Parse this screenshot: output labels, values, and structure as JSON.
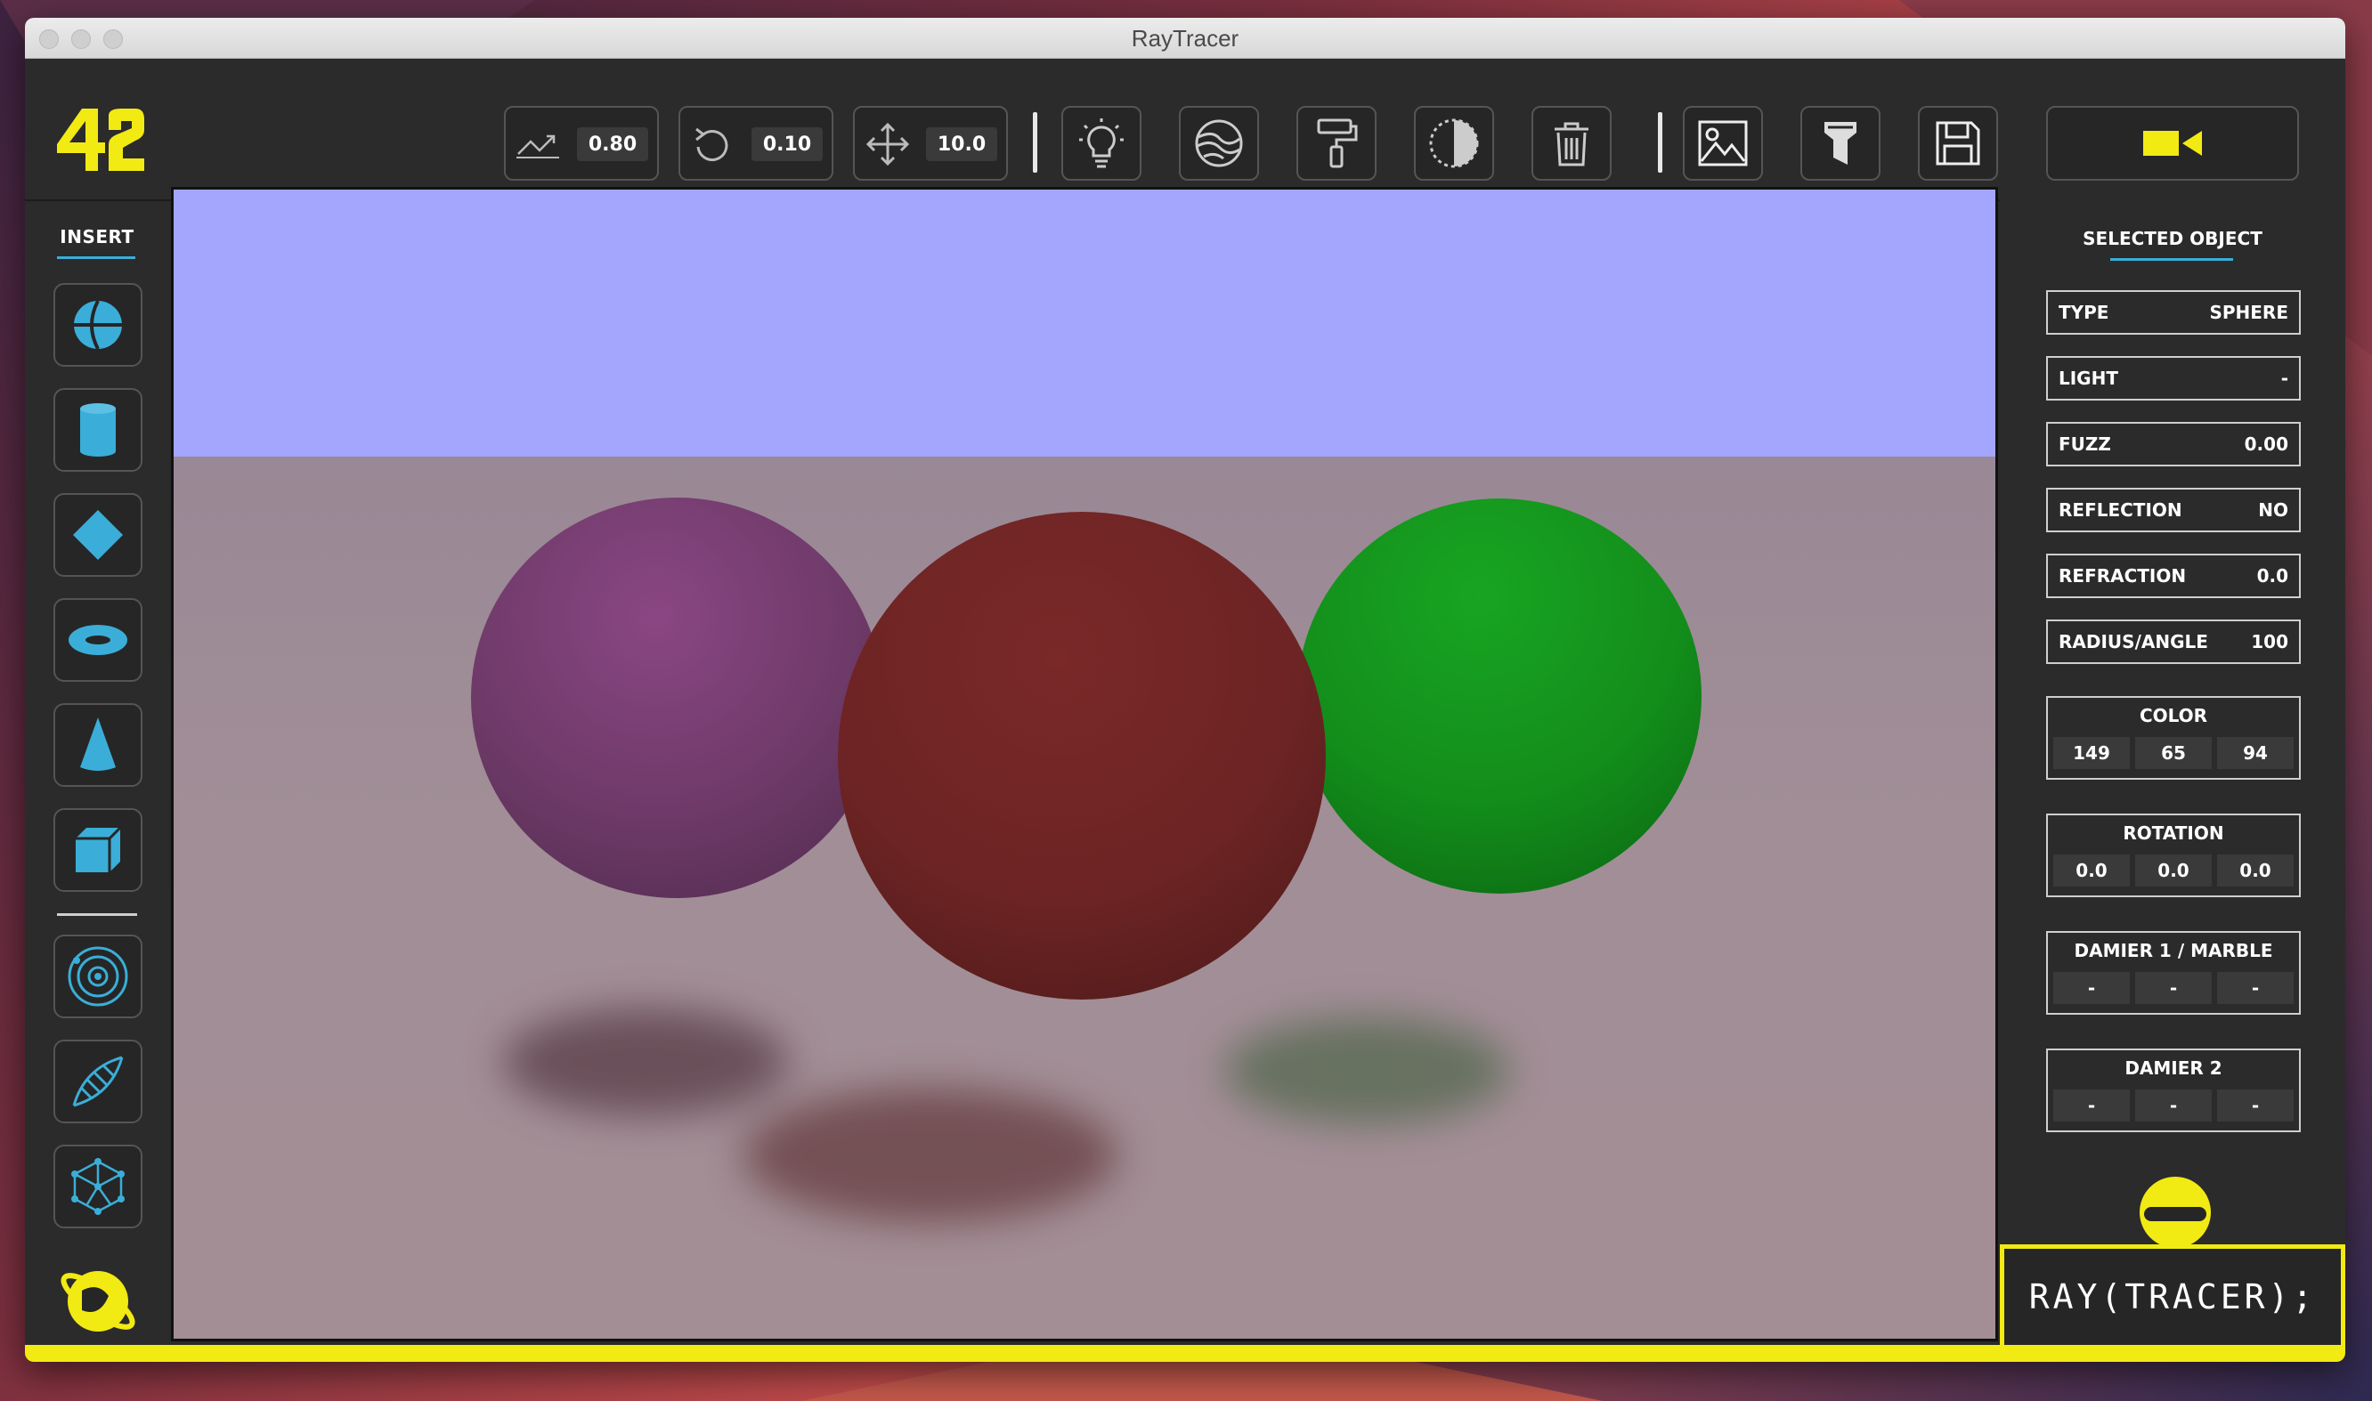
{
  "window": {
    "title": "RayTracer"
  },
  "colors": {
    "accent_yellow": "#f2ea13",
    "accent_blue": "#3aaed8",
    "sky": "#a3a6fc",
    "floor": "#a18e97"
  },
  "brand": {
    "logo_text": "42"
  },
  "toolbar": {
    "scale_value": "0.80",
    "rotate_value": "0.10",
    "move_value": "10.0",
    "tools": [
      "scale-icon",
      "rotate-icon",
      "move-icon",
      "light-bulb-icon",
      "sphere-texture-icon",
      "paint-roller-icon",
      "contrast-icon",
      "trash-icon",
      "image-icon",
      "filter-icon",
      "save-icon",
      "video-camera-icon"
    ]
  },
  "sidebar": {
    "insert_label": "INSERT",
    "items": [
      "sphere-icon",
      "cylinder-icon",
      "plane-diamond-icon",
      "torus-icon",
      "cone-icon",
      "cube-icon",
      "orbit-icon",
      "dna-icon",
      "mesh-icon"
    ]
  },
  "scene": {
    "spheres": [
      {
        "name": "purple",
        "color": "#7d3f77"
      },
      {
        "name": "red",
        "color": "#6d2424"
      },
      {
        "name": "green",
        "color": "#138d1b"
      }
    ]
  },
  "selected": {
    "title": "SELECTED OBJECT",
    "type_label": "TYPE",
    "type_value": "SPHERE",
    "light_label": "LIGHT",
    "light_value": "-",
    "fuzz_label": "FUZZ",
    "fuzz_value": "0.00",
    "reflection_label": "REFLECTION",
    "reflection_value": "NO",
    "refraction_label": "REFRACTION",
    "refraction_value": "0.0",
    "radius_label": "RADIUS/ANGLE",
    "radius_value": "100",
    "color": {
      "label": "COLOR",
      "r": "149",
      "g": "65",
      "b": "94"
    },
    "rotation": {
      "label": "ROTATION",
      "x": "0.0",
      "y": "0.0",
      "z": "0.0"
    },
    "damier1": {
      "label": "DAMIER 1 / MARBLE",
      "a": "-",
      "b": "-",
      "c": "-"
    },
    "damier2": {
      "label": "DAMIER 2",
      "a": "-",
      "b": "-",
      "c": "-"
    }
  },
  "footer": {
    "brand_text": "RAY(TRACER);"
  }
}
